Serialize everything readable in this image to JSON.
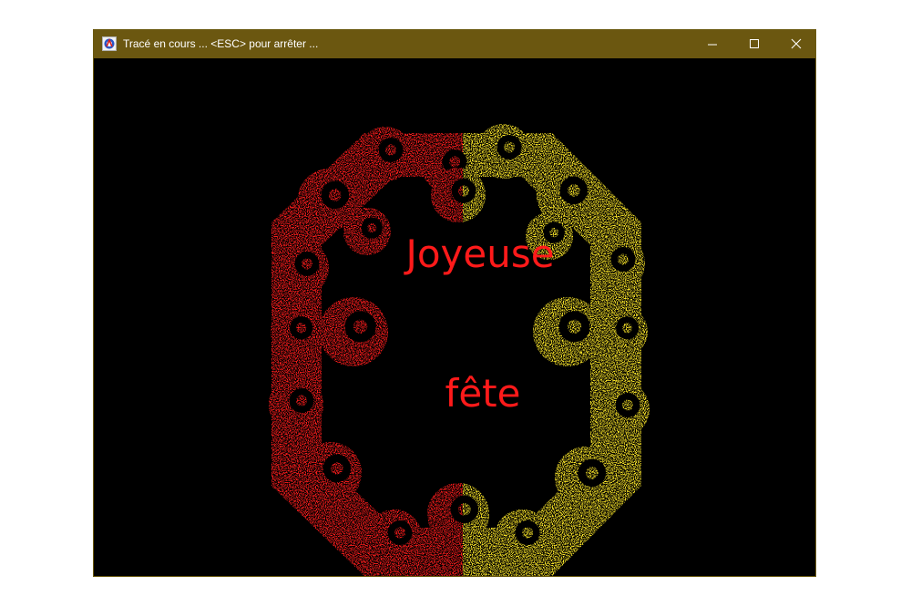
{
  "window": {
    "title": "Tracé en cours ... <ESC> pour arrêter ...",
    "icon": "app-icon",
    "controls": [
      "minimize-icon",
      "maximize-icon",
      "close-icon"
    ]
  },
  "canvas": {
    "background": "#000000",
    "text_line_1": "Joyeuse",
    "text_line_2": "fête",
    "text_color": "#ff1a1a",
    "fractal_colors": [
      "#ff1f1f",
      "#ffea2a"
    ],
    "fractal_shape": "octagon-frame"
  },
  "colors": {
    "titlebar": "#6b5710",
    "title_text": "#ffffff"
  }
}
